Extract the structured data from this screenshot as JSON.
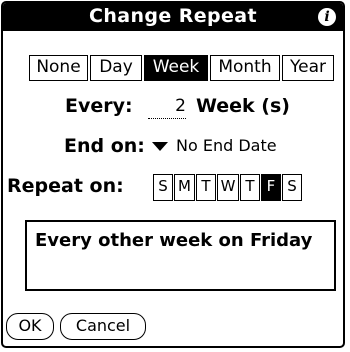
{
  "dialog": {
    "title": "Change Repeat",
    "info_icon": "info-icon"
  },
  "repeat_types": [
    {
      "label": "None",
      "selected": false
    },
    {
      "label": "Day",
      "selected": false
    },
    {
      "label": "Week",
      "selected": true
    },
    {
      "label": "Month",
      "selected": false
    },
    {
      "label": "Year",
      "selected": false
    }
  ],
  "every": {
    "label": "Every:",
    "value": "2",
    "units": "Week (s)"
  },
  "end_on": {
    "label": "End on:",
    "value": "No End Date"
  },
  "repeat_on": {
    "label": "Repeat on:",
    "days": [
      {
        "label": "S",
        "selected": false
      },
      {
        "label": "M",
        "selected": false
      },
      {
        "label": "T",
        "selected": false
      },
      {
        "label": "W",
        "selected": false
      },
      {
        "label": "T",
        "selected": false
      },
      {
        "label": "F",
        "selected": true
      },
      {
        "label": "S",
        "selected": false
      }
    ]
  },
  "description": "Every other week on Friday",
  "buttons": {
    "ok": "OK",
    "cancel": "Cancel"
  }
}
